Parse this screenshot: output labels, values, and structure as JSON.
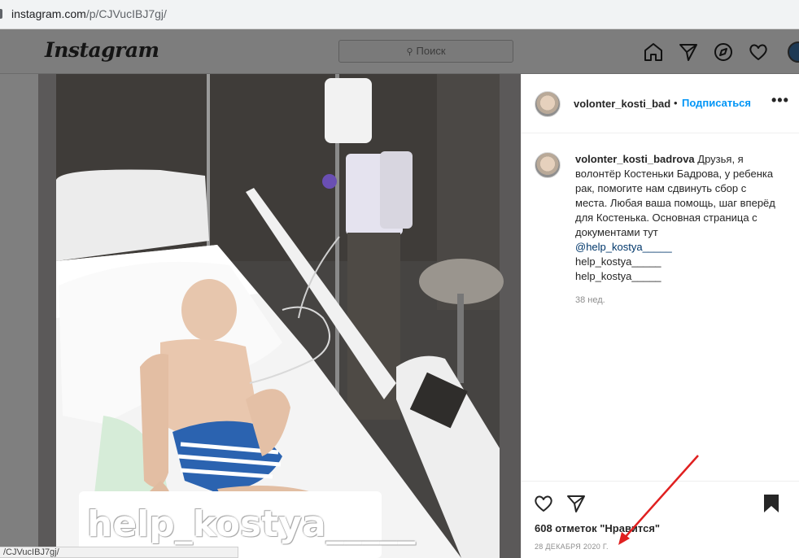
{
  "browser": {
    "url_host": "instagram.com",
    "url_path": "/p/CJVucIBJ7gj/"
  },
  "topnav": {
    "logo": "Instagram",
    "search_placeholder": "Поиск",
    "icons": [
      "home-icon",
      "direct-icon",
      "explore-icon",
      "activity-heart-icon",
      "profile-avatar"
    ]
  },
  "photo": {
    "overlay_text": "help_kostya_____"
  },
  "post": {
    "username": "volonter_kosti_bad",
    "separator": "•",
    "follow_label": "Подписаться",
    "more_label": "•••",
    "caption": {
      "username": "volonter_kosti_badrova",
      "text": "Друзья, я волонтёр Костеньки Бадрова, у ребенка рак, помогите нам сдвинуть сбор с места. Любая ваша помощь, шаг вперёд для Костенька. Основная страница с документами тут",
      "mention": "@help_kostya_____",
      "line2": "help_kostya_____",
      "line3": "help_kostya_____"
    },
    "age": "38 нед.",
    "likes": "608 отметок \"Нравится\"",
    "date": "28 ДЕКАБРЯ 2020 Г."
  },
  "status_link": "/CJVucIBJ7gj/",
  "colors": {
    "follow_blue": "#0095f6",
    "mention_blue": "#00376b",
    "annotation_red": "#e02020"
  }
}
